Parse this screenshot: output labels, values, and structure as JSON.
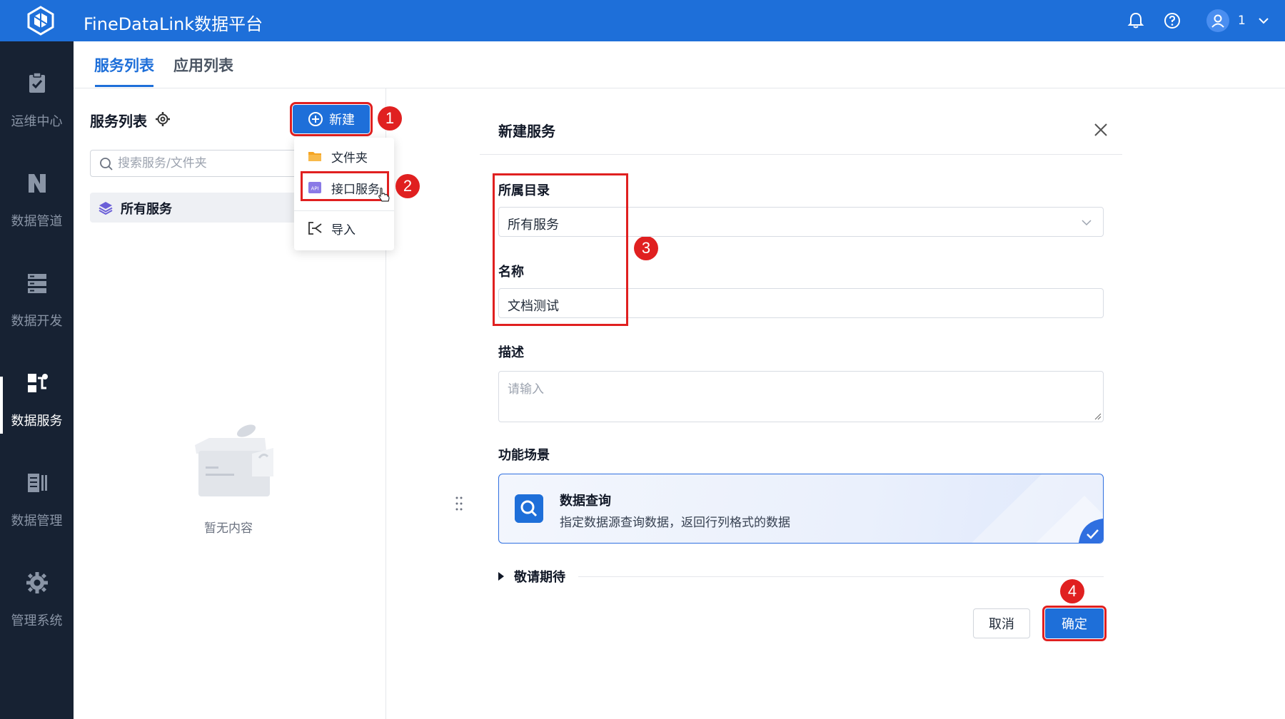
{
  "app": {
    "title": "FineDataLink数据平台"
  },
  "header": {
    "user_name": "1"
  },
  "sidebar": {
    "items": [
      {
        "label": "运维中心",
        "icon": "clipboard-check-icon"
      },
      {
        "label": "数据管道",
        "icon": "pipeline-icon"
      },
      {
        "label": "数据开发",
        "icon": "server-stack-icon"
      },
      {
        "label": "数据服务",
        "icon": "data-service-icon",
        "active": true
      },
      {
        "label": "数据管理",
        "icon": "data-management-icon"
      },
      {
        "label": "管理系统",
        "icon": "gear-icon"
      }
    ]
  },
  "tabs": [
    {
      "label": "服务列表",
      "active": true
    },
    {
      "label": "应用列表",
      "active": false
    }
  ],
  "list_panel": {
    "title": "服务列表",
    "new_button": "新建",
    "search_placeholder": "搜索服务/文件夹",
    "all_services": "所有服务",
    "empty_text": "暂无内容"
  },
  "new_menu": {
    "items": [
      {
        "label": "文件夹",
        "icon": "folder-icon"
      },
      {
        "label": "接口服务",
        "icon": "api-icon"
      },
      {
        "label": "导入",
        "icon": "import-icon"
      }
    ]
  },
  "dialog": {
    "title": "新建服务",
    "directory_label": "所属目录",
    "directory_value": "所有服务",
    "name_label": "名称",
    "name_value": "文档测试",
    "description_label": "描述",
    "description_placeholder": "请输入",
    "scenario_label": "功能场景",
    "scenario": {
      "title": "数据查询",
      "description": "指定数据源查询数据，返回行列格式的数据",
      "selected": true
    },
    "more_label": "敬请期待",
    "cancel_button": "取消",
    "ok_button": "确定"
  },
  "step_badges": [
    "1",
    "2",
    "3",
    "4"
  ],
  "colors": {
    "primary": "#1e6fd9",
    "nav_bg": "#172233",
    "highlight": "#e02020"
  }
}
